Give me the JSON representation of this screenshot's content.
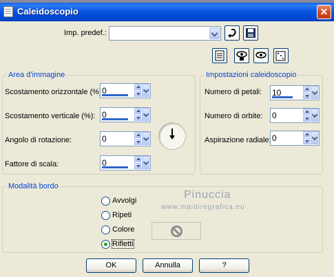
{
  "window": {
    "title": "Caleidoscopio",
    "close_label": "✕"
  },
  "preset": {
    "label": "Imp. predef.:",
    "value": ""
  },
  "area_group": {
    "title": "Area d'immagine",
    "fields": [
      {
        "label": "Scostamento orizzontale (%):",
        "value": "0"
      },
      {
        "label": "Scostamento verticale (%):",
        "value": "0"
      },
      {
        "label": "Angolo di rotazione:",
        "value": "0"
      },
      {
        "label": "Fattore di scala:",
        "value": "0"
      }
    ]
  },
  "kaleido_group": {
    "title": "Impostazioni caleidoscopio",
    "fields": [
      {
        "label": "Numero di petali:",
        "value": "10"
      },
      {
        "label": "Numero di orbite:",
        "value": "0"
      },
      {
        "label": "Aspirazione radiale:",
        "value": "0"
      }
    ]
  },
  "edge_group": {
    "title": "Modalità bordo",
    "options": [
      {
        "label": "Avvolgi",
        "selected": false
      },
      {
        "label": "Ripeti",
        "selected": false
      },
      {
        "label": "Colore",
        "selected": false
      },
      {
        "label": "Rifletti",
        "selected": true
      }
    ]
  },
  "watermark": {
    "name": "Pinuccia",
    "site": "www.maidiregrafica.eu"
  },
  "buttons": {
    "ok": "OK",
    "cancel": "Annulla",
    "help": "?"
  }
}
